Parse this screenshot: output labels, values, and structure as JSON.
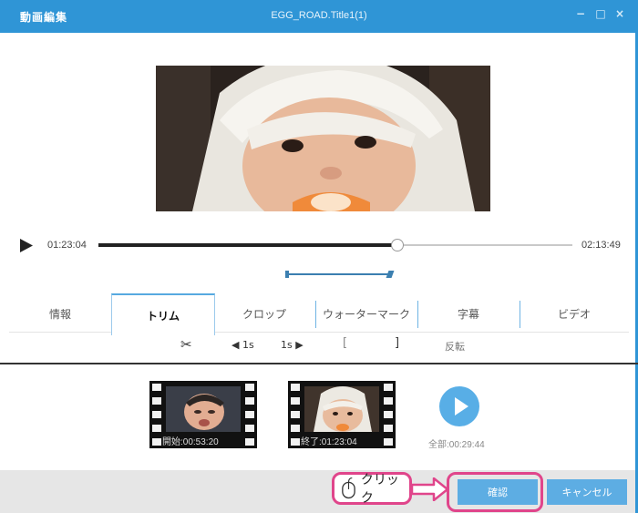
{
  "window": {
    "app_title": "動画編集",
    "title": "EGG_ROAD.Title1(1)",
    "minimize_glyph": "−",
    "maximize_glyph": "□",
    "close_glyph": "×"
  },
  "player": {
    "current_time": "01:23:04",
    "total_time": "02:13:49",
    "progress_fraction": 0.63
  },
  "tabs": [
    {
      "label": "情報"
    },
    {
      "label": "トリム",
      "active": true
    },
    {
      "label": "クロップ"
    },
    {
      "label": "ウォーターマーク"
    },
    {
      "label": "字幕"
    },
    {
      "label": "ビデオ"
    }
  ],
  "trim_tools": {
    "cut_glyph": "✂",
    "step_back": "◀ 1s",
    "step_fwd": "1s ▶",
    "bracket_open": "[",
    "bracket_close": "]",
    "reverse": "反転"
  },
  "clips": {
    "start_label": "開始:00:53:20",
    "end_label": "終了:01:23:04",
    "total_label": "全部:00:29:44"
  },
  "footer": {
    "confirm": "確認",
    "cancel": "キャンセル"
  },
  "annotation": {
    "click_text": "クリック"
  },
  "colors": {
    "accent": "#2f95d6",
    "button": "#5dade3",
    "highlight": "#e0458b"
  },
  "icons": [
    "play-icon",
    "scissors-icon",
    "mouse-icon",
    "play-circle-icon",
    "arrow-right-icon"
  ]
}
